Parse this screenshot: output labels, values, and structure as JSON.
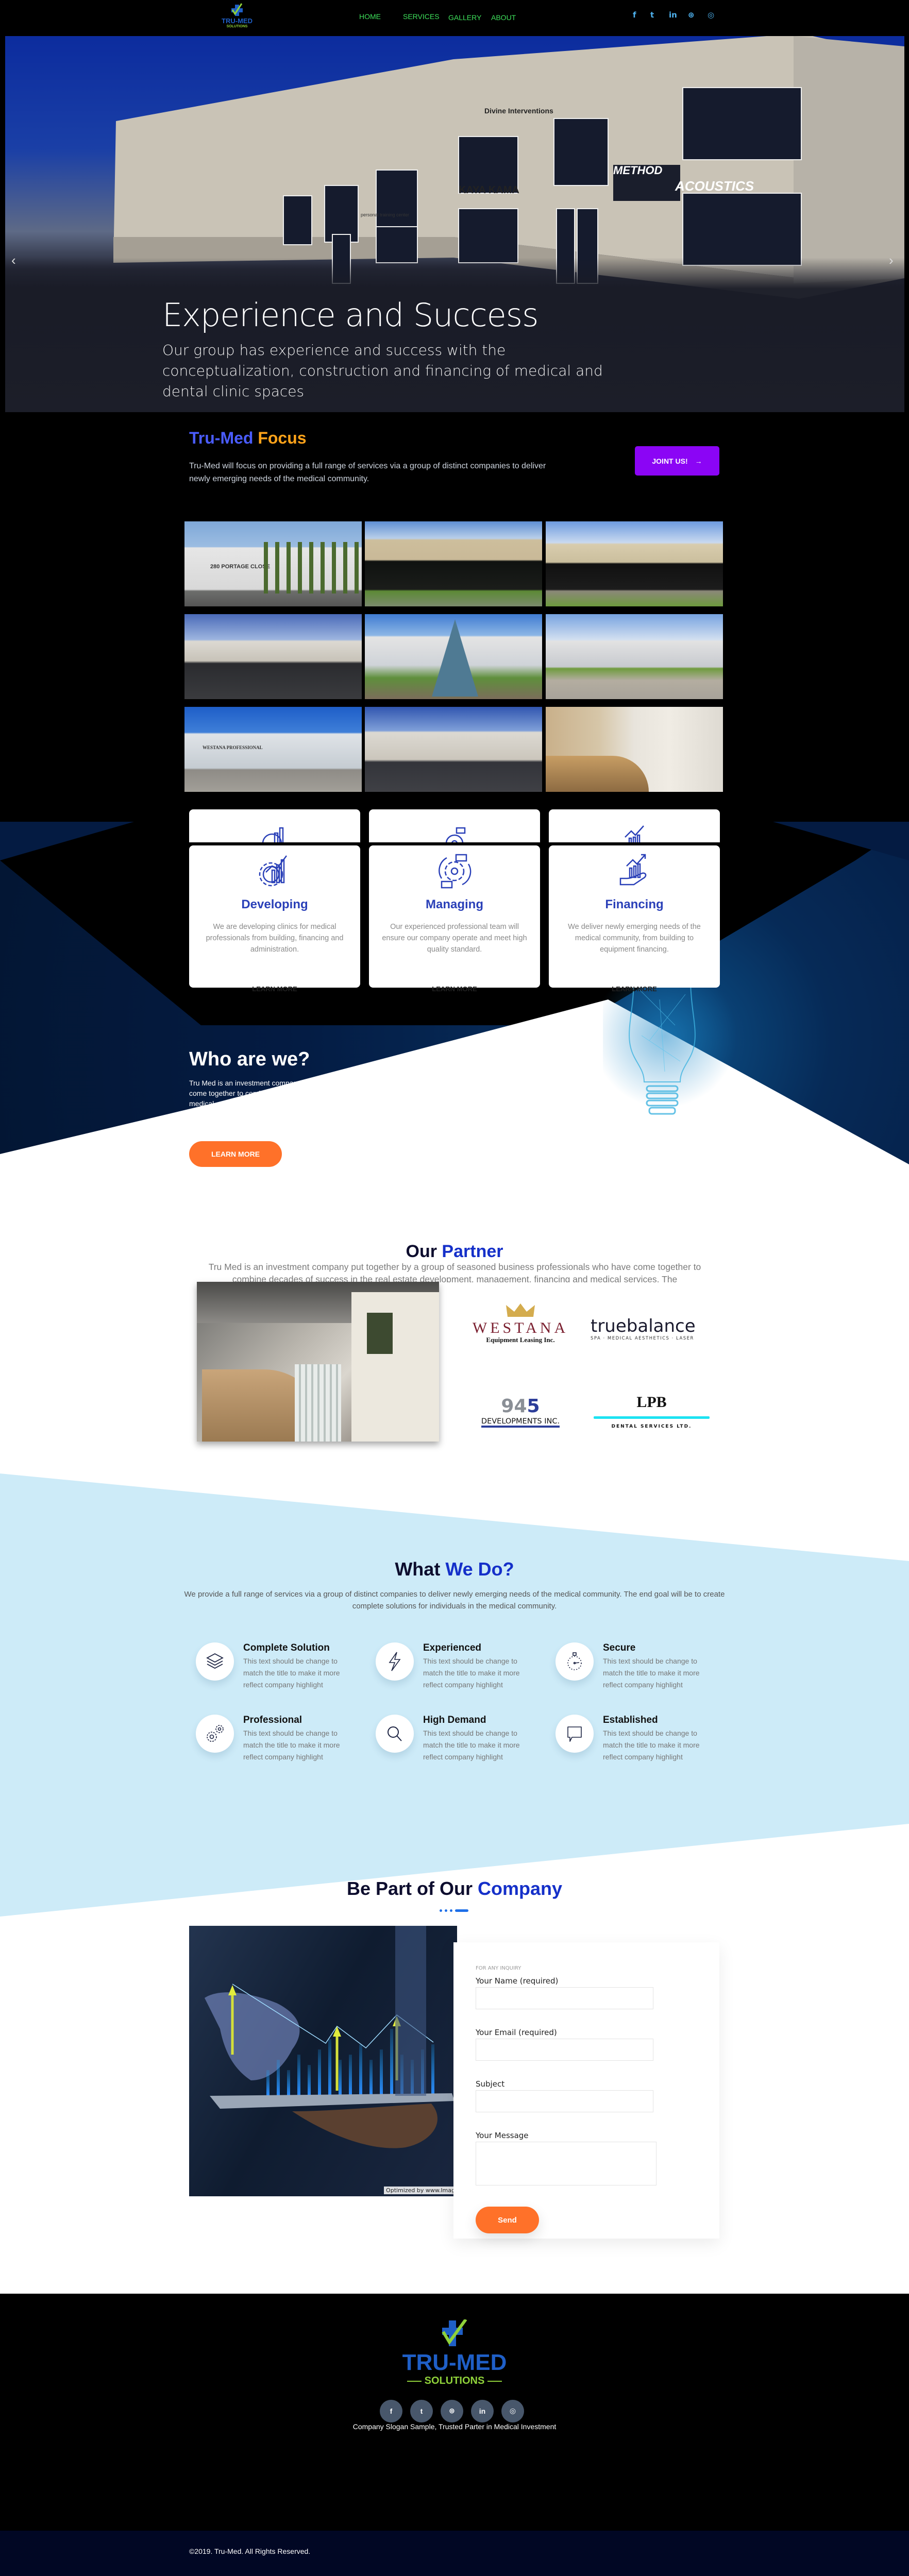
{
  "header": {
    "logo": {
      "main": "TRU-MED",
      "sub": "SOLUTIONS"
    },
    "nav": [
      {
        "label": "HOME"
      },
      {
        "label": "SERVICES"
      },
      {
        "label": "GALLERY"
      },
      {
        "label": "ABOUT"
      }
    ],
    "social": [
      "facebook-icon",
      "twitter-icon",
      "linkedin-icon",
      "dribbble-icon",
      "instagram-icon"
    ]
  },
  "hero": {
    "title": "Experience and Success",
    "subtitle": "Our group has experience and success with the conceptualization, construction and financing of medical and dental clinic spaces",
    "signs": [
      "Divine Interventions",
      "KAYA KAMA",
      "METHOD",
      "ACOUSTICS",
      "personal training center"
    ],
    "prev": "‹",
    "next": "›"
  },
  "focus": {
    "title_part1": "Tru-Med",
    "title_part2": "Focus",
    "text": "Tru-Med will focus on providing a full range of services via a group of distinct companies to deliver newly emerging needs of the medical community.",
    "button": "JOINT US!",
    "button_arrow": "→",
    "colors": {
      "title1": "#4a5cff",
      "title2": "#ffa31a",
      "button": "#8b05f5"
    }
  },
  "gallery": {
    "images": [
      {
        "label": "280 PORTAGE CLOSE"
      },
      {
        "label": ""
      },
      {
        "label": ""
      },
      {
        "label": ""
      },
      {
        "label": ""
      },
      {
        "label": ""
      },
      {
        "label": "WESTANA PROFESSIONAL"
      },
      {
        "label": ""
      },
      {
        "label": ""
      }
    ]
  },
  "services": [
    {
      "title": "Developing",
      "text": "We are developing clinics for medical professionals from building, financing and administration.",
      "link": "LEARN MORE",
      "icon": "gear-chart-icon"
    },
    {
      "title": "Managing",
      "text": "Our experienced professional team will ensure our company operate and meet high quality standard.",
      "link": "LEARN MORE",
      "icon": "gear-cycle-icon"
    },
    {
      "title": "Financing",
      "text": "We deliver newly emerging needs of the medical community, from building to equipment financing.",
      "link": "LEARN MORE",
      "icon": "hand-growth-icon"
    }
  ],
  "who": {
    "title": "Who are we?",
    "text": "Tru Med is an investment company put together by a group of seasoned business professionals who have come together to combine decades of success in the real estate development, management, financing and medical services. The company will be a full service company offering turn key solutions for medical professionals.",
    "button": "LEARN MORE"
  },
  "partner": {
    "title_part1": "Our",
    "title_part2": "Partner",
    "text": "Tru Med is an investment company put together by a group of seasoned business professionals who have come together to combine decades of success in the real estate development, management, financing and medical services. The",
    "logos": [
      {
        "name": "WESTANA",
        "sub": "Equipment Leasing Inc."
      },
      {
        "name": "truebalance",
        "sub": "SPA · MEDICAL AESTHETICS · LASER"
      },
      {
        "name": "945",
        "sub": "DEVELOPMENTS INC."
      },
      {
        "name": "LPB",
        "sub": "DENTAL SERVICES LTD."
      }
    ]
  },
  "whatwedo": {
    "title_part1": "What",
    "title_part2": "We Do?",
    "text": "We provide a full range of services via a group of distinct companies to deliver newly emerging needs of the medical community. The end goal will be to create complete solutions for individuals in the medical community.",
    "features": [
      {
        "title": "Complete Solution",
        "text": "This text should be change to match the title to make it more reflect company highlight",
        "icon": "layers-icon"
      },
      {
        "title": "Experienced",
        "text": "This text should be change to match the title to make it more reflect company highlight",
        "icon": "lightning-icon"
      },
      {
        "title": "Secure",
        "text": "This text should be change to match the title to make it more reflect company highlight",
        "icon": "stopwatch-icon"
      },
      {
        "title": "Professional",
        "text": "This text should be change to match the title to make it more reflect company highlight",
        "icon": "gears-icon"
      },
      {
        "title": "High Demand",
        "text": "This text should be change to match the title to make it more reflect company highlight",
        "icon": "search-icon"
      },
      {
        "title": "Established",
        "text": "This text should be change to match the title to make it more reflect company highlight",
        "icon": "chat-icon"
      }
    ]
  },
  "contact": {
    "title_part1": "Be Part of Our",
    "title_part2": "Company",
    "photo_caption": "Optimized by www.Imag",
    "form": {
      "eyebrow": "FOR ANY INQUIRY",
      "fields": [
        {
          "label": "Your Name (required)",
          "value": ""
        },
        {
          "label": "Your Email (required)",
          "value": ""
        },
        {
          "label": "Subject",
          "value": ""
        },
        {
          "label": "Your Message",
          "value": ""
        }
      ],
      "submit": "Send"
    }
  },
  "footer": {
    "logo_main": "TRU-MED",
    "logo_sub": "SOLUTIONS",
    "slogan": "Company Slogan Sample, Trusted Parter in Medical Investment",
    "social": [
      "facebook-icon",
      "twitter-icon",
      "dribbble-icon",
      "linkedin-icon",
      "instagram-icon"
    ],
    "copyright": "©2019. Tru-Med. All Rights Reserved."
  },
  "colors": {
    "accent_blue": "#1530c9",
    "orange": "#ff7129",
    "nav_green": "#3ee05b",
    "light_blue_bg": "#cdebf8",
    "footer_bottom": "#010724"
  }
}
